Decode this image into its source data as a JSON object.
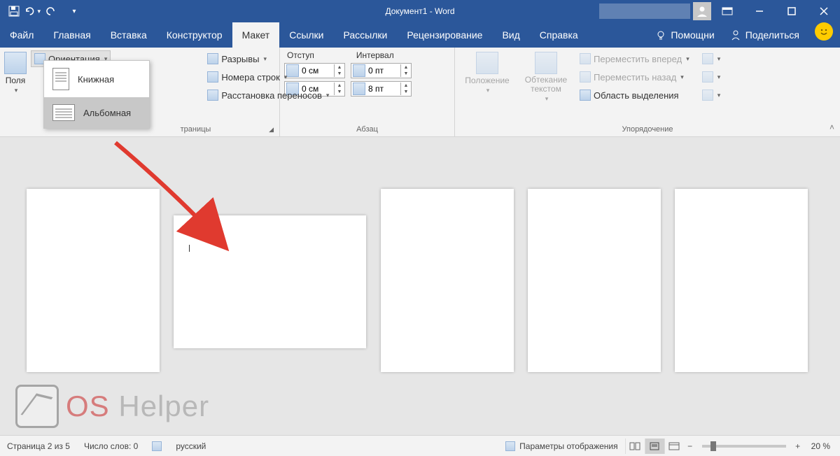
{
  "title": "Документ1 - Word",
  "qat": {
    "save": "save",
    "undo": "undo",
    "redo": "redo"
  },
  "tabs": {
    "file": "Файл",
    "home": "Главная",
    "insert": "Вставка",
    "design": "Конструктор",
    "layout": "Макет",
    "references": "Ссылки",
    "mailings": "Рассылки",
    "review": "Рецензирование",
    "view": "Вид",
    "help": "Справка"
  },
  "tellme": "Помощни",
  "share": "Поделиться",
  "ribbon": {
    "margins": "Поля",
    "orientation": {
      "label": "Ориентация",
      "portrait": "Книжная",
      "landscape": "Альбомная"
    },
    "breaks": "Разрывы",
    "line_numbers": "Номера строк",
    "hyphenation": "Расстановка переносов",
    "group_pagesetup_tail": "траницы",
    "indent_label": "Отступ",
    "spacing_label": "Интервал",
    "indent_left": "0 см",
    "indent_right": "0 см",
    "spacing_before": "0 пт",
    "spacing_after": "8 пт",
    "group_paragraph": "Абзац",
    "position": "Положение",
    "wrap": "Обтекание текстом",
    "bring_forward": "Переместить вперед",
    "send_backward": "Переместить назад",
    "selection_pane": "Область выделения",
    "group_arrange": "Упорядочение"
  },
  "status": {
    "page": "Страница 2 из 5",
    "words": "Число слов: 0",
    "lang": "русский",
    "display": "Параметры отображения",
    "zoom": "20 %"
  },
  "watermark": {
    "os": "OS ",
    "helper": "Helper"
  }
}
